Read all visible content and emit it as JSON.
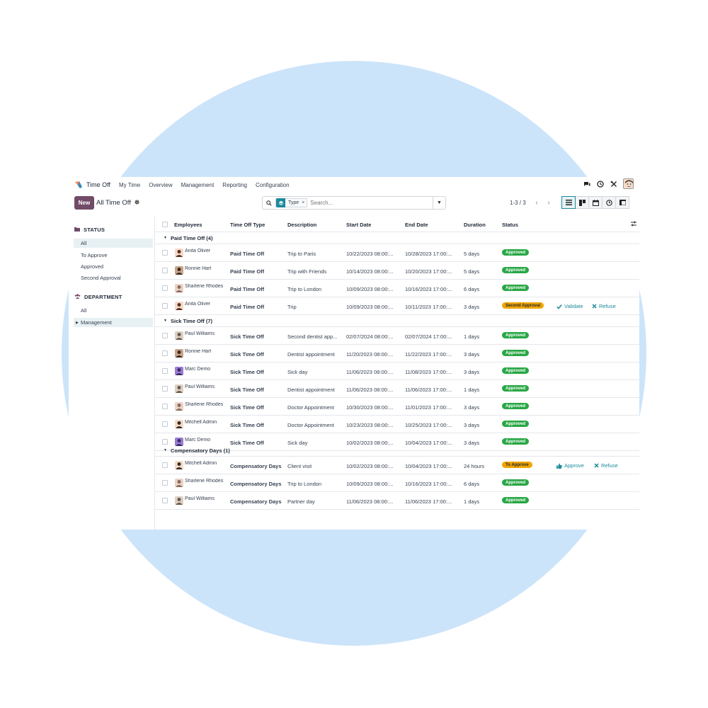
{
  "app": {
    "title": "Time Off",
    "menu": [
      "My Time",
      "Overview",
      "Management",
      "Reporting",
      "Configuration"
    ]
  },
  "control": {
    "new_label": "New",
    "breadcrumb": "All Time Off",
    "facet_label": "Type",
    "search_placeholder": "Search...",
    "pager": "1-3 / 3"
  },
  "sidebar": {
    "status_header": "STATUS",
    "status_items": [
      "All",
      "To Approve",
      "Approved",
      "Second Approval"
    ],
    "department_header": "DEPARTMENT",
    "department_items": [
      "All",
      "Management"
    ]
  },
  "columns": [
    "Employees",
    "Time Off Type",
    "Description",
    "Start Date",
    "End Date",
    "Duration",
    "Status"
  ],
  "groups": [
    {
      "label": "Paid Time Off (4)",
      "rows": [
        {
          "employee": "Anita Oliver",
          "type": "Paid Time Off",
          "description": "Trip to Paris",
          "start": "10/22/2023 08:00:...",
          "end": "10/28/2023 17:00:...",
          "duration": "5 days",
          "status": "Approved",
          "status_kind": "approved"
        },
        {
          "employee": "Ronnie Hart",
          "type": "Paid Time Off",
          "description": "Trip with Friends",
          "start": "10/14/2023 08:00:...",
          "end": "10/20/2023 17:00:...",
          "duration": "5 days",
          "status": "Approved",
          "status_kind": "approved"
        },
        {
          "employee": "Sharlene Rhodes",
          "type": "Paid Time Off",
          "description": "Trip to London",
          "start": "10/09/2023 08:00:...",
          "end": "10/16/2023 17:00:...",
          "duration": "6 days",
          "status": "Approved",
          "status_kind": "approved"
        },
        {
          "employee": "Anita Oliver",
          "type": "Paid Time Off",
          "description": "Trip",
          "start": "10/09/2023 08:00:...",
          "end": "10/11/2023 17:00:...",
          "duration": "3 days",
          "status": "Second Approval",
          "status_kind": "second",
          "actions": [
            "Validate",
            "Refuse"
          ]
        }
      ]
    },
    {
      "label": "Sick Time Off (7)",
      "rows": [
        {
          "employee": "Paul Williams",
          "type": "Sick Time Off",
          "description": "Second dentist app...",
          "start": "02/07/2024 08:00:...",
          "end": "02/07/2024 17:00:...",
          "duration": "1 days",
          "status": "Approved",
          "status_kind": "approved"
        },
        {
          "employee": "Ronnie Hart",
          "type": "Sick Time Off",
          "description": "Dentist appointment",
          "start": "11/20/2023 08:00:...",
          "end": "11/22/2023 17:00:...",
          "duration": "3 days",
          "status": "Approved",
          "status_kind": "approved"
        },
        {
          "employee": "Marc Demo",
          "type": "Sick Time Off",
          "description": "Sick day",
          "start": "11/06/2023 08:00:...",
          "end": "11/08/2023 17:00:...",
          "duration": "3 days",
          "status": "Approved",
          "status_kind": "approved"
        },
        {
          "employee": "Paul Williams",
          "type": "Sick Time Off",
          "description": "Dentist appointment",
          "start": "11/06/2023 08:00:...",
          "end": "11/06/2023 17:00:...",
          "duration": "1 days",
          "status": "Approved",
          "status_kind": "approved"
        },
        {
          "employee": "Sharlene Rhodes",
          "type": "Sick Time Off",
          "description": "Doctor Appointment",
          "start": "10/30/2023 08:00:...",
          "end": "11/01/2023 17:00:...",
          "duration": "3 days",
          "status": "Approved",
          "status_kind": "approved"
        },
        {
          "employee": "Mitchell Admin",
          "type": "Sick Time Off",
          "description": "Doctor Appointment",
          "start": "10/23/2023 08:00:...",
          "end": "10/25/2023 17:00:...",
          "duration": "3 days",
          "status": "Approved",
          "status_kind": "approved"
        },
        {
          "employee": "Marc Demo",
          "type": "Sick Time Off",
          "description": "Sick day",
          "start": "10/02/2023 08:00:...",
          "end": "10/04/2023 17:00:...",
          "duration": "3 days",
          "status": "Approved",
          "status_kind": "approved"
        }
      ]
    },
    {
      "label": "Compensatory Days (1)",
      "rows": [
        {
          "employee": "Mitchell Admin",
          "type": "Compensatory Days",
          "description": "Client visit",
          "start": "10/02/2023 08:00:...",
          "end": "10/04/2023 17:00:...",
          "duration": "24 hours",
          "status": "To Approve",
          "status_kind": "toapprove",
          "actions": [
            "Approve",
            "Refuse"
          ]
        },
        {
          "employee": "Sharlene Rhodes",
          "type": "Compensatory Days",
          "description": "Trip to London",
          "start": "10/09/2023 08:00:...",
          "end": "10/16/2023 17:00:...",
          "duration": "6 days",
          "status": "Approved",
          "status_kind": "approved"
        },
        {
          "employee": "Paul Williams",
          "type": "Compensatory Days",
          "description": "Partner day",
          "start": "11/06/2023 08:00:...",
          "end": "11/06/2023 17:00:...",
          "duration": "1 days",
          "status": "Approved",
          "status_kind": "approved"
        }
      ]
    }
  ],
  "colors": {
    "background_circle": "#cce4fa",
    "brand": "#714b67",
    "accent": "#1b8a9b",
    "approved": "#28a745",
    "pending": "#f0a500"
  },
  "icons": {
    "app_logo": "time-off-logo-icon",
    "chat": "chat-icon",
    "clock": "clock-icon",
    "tools": "tools-icon",
    "user": "user-avatar",
    "gear": "gear-icon",
    "search": "search-icon",
    "facet": "layers-icon",
    "toggle": "caret-down-icon",
    "prev": "chevron-left-icon",
    "next": "chevron-right-icon",
    "views": [
      "list-view-icon",
      "kanban-view-icon",
      "calendar-view-icon",
      "activity-view-icon",
      "pivot-view-icon"
    ],
    "status_folder": "folder-icon",
    "department": "users-icon",
    "optional_columns": "sliders-icon"
  }
}
